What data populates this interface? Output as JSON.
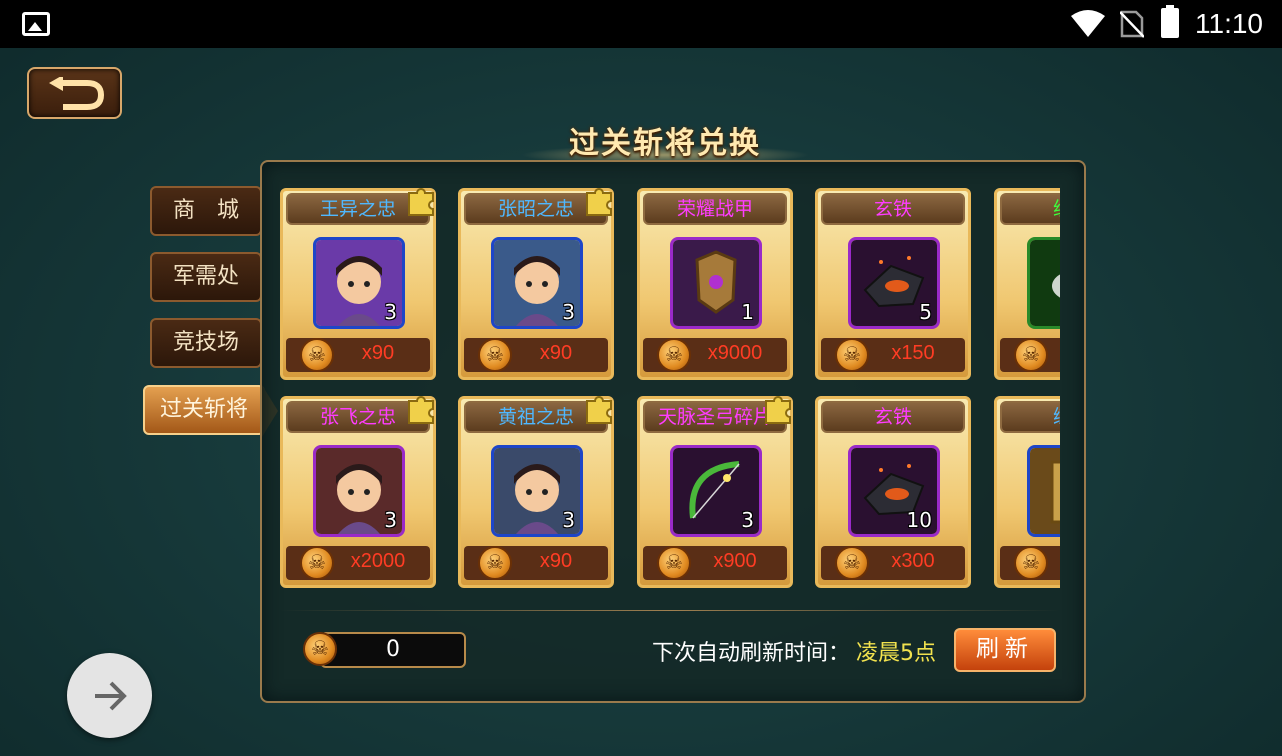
{
  "status_bar": {
    "time": "11:10",
    "icons": [
      "image-icon",
      "wifi-icon",
      "no-sim-icon",
      "battery-icon"
    ]
  },
  "header": {
    "title": "过关斩将兑换",
    "back_icon": "back-arrow-icon"
  },
  "tabs": [
    {
      "label": "商　城",
      "active": false
    },
    {
      "label": "军需处",
      "active": false
    },
    {
      "label": "竞技场",
      "active": false
    },
    {
      "label": "过关斩将",
      "active": true
    }
  ],
  "items_row1": [
    {
      "name": "王异之忠",
      "name_color": "#4fb8ff",
      "quantity": "3",
      "price": "x90",
      "frame": "#1e46c8",
      "bg": "#6a3aa8",
      "fragment": true,
      "icon": "hero-portrait-icon"
    },
    {
      "name": "张昭之忠",
      "name_color": "#4fb8ff",
      "quantity": "3",
      "price": "x90",
      "frame": "#1e46c8",
      "bg": "#3a5a8a",
      "fragment": true,
      "icon": "hero-portrait-icon"
    },
    {
      "name": "荣耀战甲",
      "name_color": "#ff3cff",
      "quantity": "1",
      "price": "x9000",
      "frame": "#9a2ac8",
      "bg": "#3a1a4a",
      "fragment": false,
      "icon": "armor-icon"
    },
    {
      "name": "玄铁",
      "name_color": "#ff3cff",
      "quantity": "5",
      "price": "x150",
      "frame": "#9a2ac8",
      "bg": "#2a1030",
      "fragment": false,
      "icon": "iron-ore-icon"
    },
    {
      "name": "纹钢",
      "name_color": "#3cff3c",
      "quantity": "",
      "price": "",
      "frame": "#2a8a2a",
      "bg": "#103a10",
      "fragment": false,
      "icon": "steel-icon"
    }
  ],
  "items_row2": [
    {
      "name": "张飞之忠",
      "name_color": "#ff3cff",
      "quantity": "3",
      "price": "x2000",
      "frame": "#9a2ac8",
      "bg": "#5a2a2a",
      "fragment": true,
      "icon": "hero-portrait-icon"
    },
    {
      "name": "黄祖之忠",
      "name_color": "#4fb8ff",
      "quantity": "3",
      "price": "x90",
      "frame": "#1e46c8",
      "bg": "#3a4a6a",
      "fragment": true,
      "icon": "hero-portrait-icon"
    },
    {
      "name": "天脉圣弓碎片",
      "name_color": "#ff3cff",
      "quantity": "3",
      "price": "x900",
      "frame": "#9a2ac8",
      "bg": "#2a1030",
      "fragment": true,
      "icon": "bow-icon"
    },
    {
      "name": "玄铁",
      "name_color": "#ff3cff",
      "quantity": "10",
      "price": "x300",
      "frame": "#9a2ac8",
      "bg": "#2a1030",
      "fragment": false,
      "icon": "iron-ore-icon"
    },
    {
      "name": "练兵",
      "name_color": "#4fb8ff",
      "quantity": "",
      "price": "",
      "frame": "#1e46c8",
      "bg": "#6a4a1a",
      "fragment": false,
      "icon": "book-icon"
    }
  ],
  "footer": {
    "balance": "0",
    "refresh_label": "下次自动刷新时间：",
    "refresh_time": "凌晨5点",
    "refresh_button": "刷新"
  }
}
